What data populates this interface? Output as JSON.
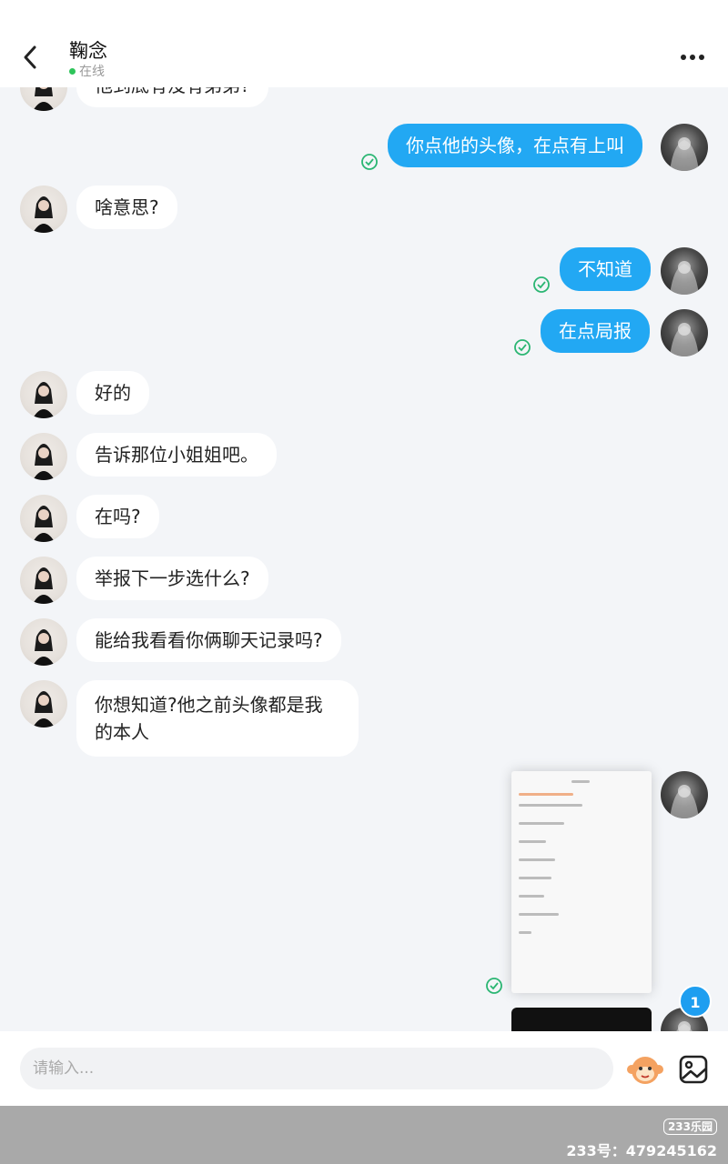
{
  "header": {
    "title": "鞠念",
    "status": "在线",
    "status_color": "#2ec45a",
    "back_icon": "chevron-left-icon",
    "more_icon": "more-dots-icon"
  },
  "messages": [
    {
      "side": "left",
      "text": "他到底有没有弟弟?"
    },
    {
      "side": "right",
      "text": "你点他的头像，在点有上叫",
      "read": true
    },
    {
      "side": "left",
      "text": "啥意思?"
    },
    {
      "side": "right",
      "text": "不知道",
      "read": true
    },
    {
      "side": "right",
      "text": "在点局报",
      "read": true
    },
    {
      "side": "left",
      "text": "好的"
    },
    {
      "side": "left",
      "text": "告诉那位小姐姐吧。"
    },
    {
      "side": "left",
      "text": "在吗?"
    },
    {
      "side": "left",
      "text": "举报下一步选什么?"
    },
    {
      "side": "left",
      "text": "能给我看看你俩聊天记录吗?"
    },
    {
      "side": "left",
      "text": "你想知道?他之前头像都是我的本人"
    }
  ],
  "unread_badge": "1",
  "input": {
    "placeholder": "请输入..."
  },
  "watermark": {
    "logo": "233乐园",
    "id_text": "233号：479245162"
  },
  "colors": {
    "bubble_mine": "#22a8f3",
    "bubble_other": "#ffffff",
    "read_check": "#2bb673"
  }
}
